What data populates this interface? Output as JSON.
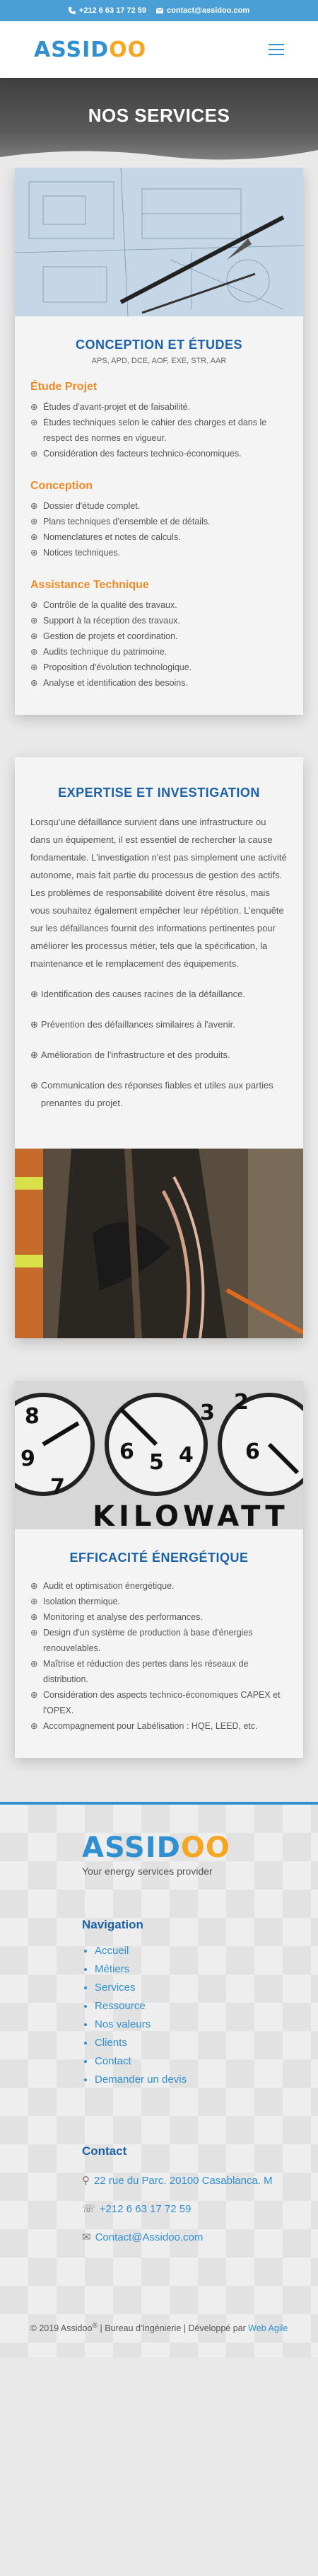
{
  "topbar": {
    "phone": "+212 6 63 17 72 59",
    "email": "contact@assidoo.com",
    "color": "#4aa0d6"
  },
  "header": {
    "logo_text_1": "ASSID",
    "logo_o": "O",
    "logo_o2": "O",
    "menu_icon": "hamburger-icon"
  },
  "hero": {
    "title": "NOS SERVICES"
  },
  "card1": {
    "title": "CONCEPTION ET ÉTUDES",
    "subtitle": "APS, APD, DCE, AOF, EXE, STR, AAR",
    "groups": [
      {
        "heading": "Étude Projet",
        "items": [
          "Études d'avant-projet et de faisabilité.",
          "Études techniques selon le cahier des charges et dans le respect des normes en vigueur.",
          "Considération des facteurs technico-économiques."
        ]
      },
      {
        "heading": "Conception",
        "items": [
          "Dossier d'étude complet.",
          "Plans techniques d'ensemble et de détails.",
          "Nomenclatures et notes de calculs.",
          "Notices techniques."
        ]
      },
      {
        "heading": "Assistance Technique",
        "items": [
          "Contrôle de la qualité des travaux.",
          "Support à la réception des travaux.",
          "Gestion de projets et coordination.",
          "Audits technique du patrimoine.",
          "Proposition d'évolution technologique.",
          "Analyse et identification des besoins."
        ]
      }
    ]
  },
  "card2": {
    "title": "EXPERTISE ET INVESTIGATION",
    "paragraph": "Lorsqu'une défaillance survient dans une infrastructure ou dans un équipement, il est essentiel de rechercher la cause fondamentale. L'investigation n'est pas simplement une activité autonome, mais fait partie du processus de gestion des actifs. Les problèmes de responsabilité doivent être résolus, mais vous souhaitez également empêcher leur répétition. L'enquête sur les défaillances fournit des informations pertinentes pour améliorer les processus métier, tels que la spécification, la maintenance et le remplacement des équipements.",
    "items": [
      "Identification des causes racines de la défaillance.",
      "Prévention des défaillances similaires à l'avenir.",
      "Amélioration de l'infrastructure et des produits.",
      "Communication des réponses fiables et utiles aux parties prenantes du projet."
    ]
  },
  "card3": {
    "image_text": "KILOWATT",
    "dial_numbers": [
      "7",
      "6",
      "5",
      "4",
      "3",
      "8",
      "2",
      "9",
      "6"
    ],
    "title": "EFFICACITÉ ÉNERGÉTIQUE",
    "items": [
      "Audit et optimisation énergétique.",
      "Isolation thermique.",
      "Monitoring et analyse des performances.",
      "Design d'un système de production à base d'énergies renouvelables.",
      "Maîtrise et réduction des pertes dans les réseaux de distribution.",
      "Considération des aspects technico-économiques CAPEX et l'OPEX.",
      "Accompagnement pour Labélisation : HQE, LEED, etc."
    ]
  },
  "footer": {
    "tagline": "Your energy services provider",
    "nav_heading": "Navigation",
    "nav_items": [
      "Accueil",
      "Métiers",
      "Services",
      "Ressource",
      "Nos valeurs",
      "Clients",
      "Contact",
      "Demander un devis"
    ],
    "contact_heading": "Contact",
    "address": "22 rue du Parc. 20100 Casablanca. M",
    "phone": "+212 6 63 17 72 59",
    "email": "Contact@Assidoo.com",
    "copyright_pre": "© 2019 Assidoo",
    "copyright_sup": "®",
    "copyright_mid": " | Bureau d'Ingénierie | Développé par ",
    "copyright_link": "Web Agile"
  }
}
